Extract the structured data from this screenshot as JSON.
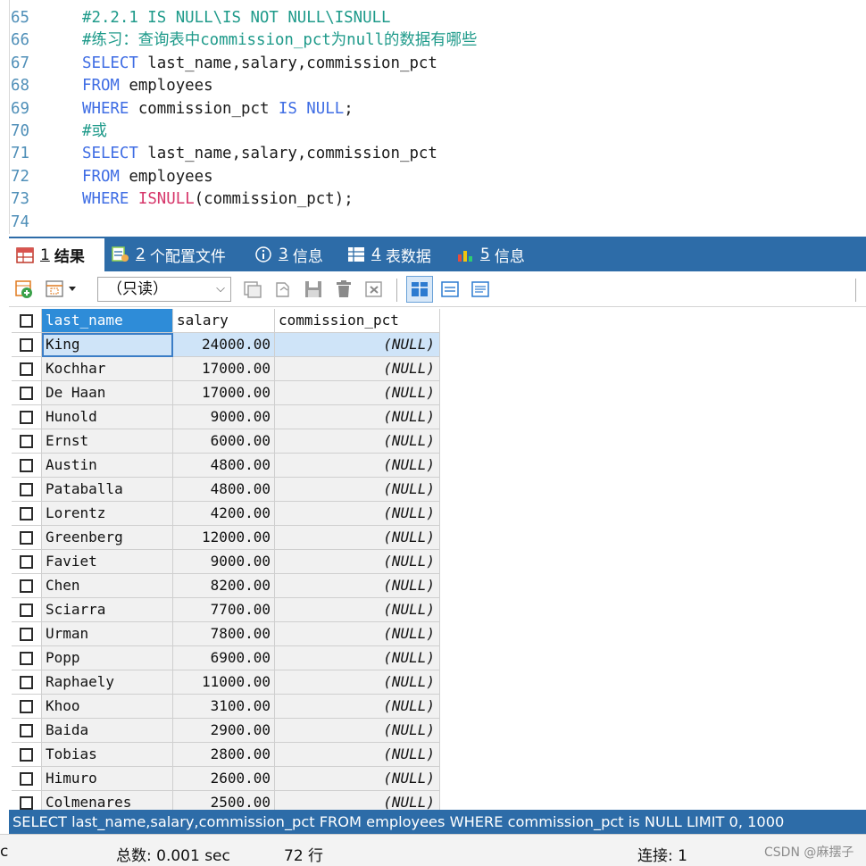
{
  "editor": {
    "lines": [
      {
        "n": "65",
        "tokens": [
          {
            "t": "#2.2.1 IS NULL\\IS NOT NULL\\ISNULL",
            "c": "cm"
          }
        ]
      },
      {
        "n": "66",
        "tokens": [
          {
            "t": "#练习：查询表中commission_pct为null的数据有哪些",
            "c": "cm"
          }
        ]
      },
      {
        "n": "67",
        "tokens": [
          {
            "t": "SELECT",
            "c": "kw"
          },
          {
            "t": " last_name,salary,commission_pct",
            "c": "id"
          }
        ]
      },
      {
        "n": "68",
        "tokens": [
          {
            "t": "FROM",
            "c": "kw"
          },
          {
            "t": " employees",
            "c": "id"
          }
        ]
      },
      {
        "n": "69",
        "tokens": [
          {
            "t": "WHERE",
            "c": "kw"
          },
          {
            "t": " commission_pct ",
            "c": "id"
          },
          {
            "t": "IS NULL",
            "c": "kw"
          },
          {
            "t": ";",
            "c": "id"
          }
        ]
      },
      {
        "n": "70",
        "tokens": [
          {
            "t": "#或",
            "c": "cm"
          }
        ]
      },
      {
        "n": "71",
        "tokens": [
          {
            "t": "SELECT",
            "c": "kw"
          },
          {
            "t": " last_name,salary,commission_pct",
            "c": "id"
          }
        ]
      },
      {
        "n": "72",
        "tokens": [
          {
            "t": "FROM",
            "c": "kw"
          },
          {
            "t": " employees",
            "c": "id"
          }
        ]
      },
      {
        "n": "73",
        "tokens": [
          {
            "t": "WHERE",
            "c": "kw"
          },
          {
            "t": " ",
            "c": "id"
          },
          {
            "t": "ISNULL",
            "c": "fn"
          },
          {
            "t": "(commission_pct);",
            "c": "id"
          }
        ]
      },
      {
        "n": "74",
        "tokens": []
      }
    ]
  },
  "tabs": [
    {
      "num": "1",
      "label": "结果",
      "icon": "grid-result-icon",
      "active": true
    },
    {
      "num": "2",
      "label": "个配置文件",
      "icon": "profile-icon",
      "active": false
    },
    {
      "num": "3",
      "label": "信息",
      "icon": "info-circle-icon",
      "active": false
    },
    {
      "num": "4",
      "label": "表数据",
      "icon": "table-data-icon",
      "active": false
    },
    {
      "num": "5",
      "label": "信息",
      "icon": "info-chart-icon",
      "active": false
    }
  ],
  "toolbar": {
    "mode_value": "（只读）",
    "icons": [
      "add-row-icon",
      "table-dropdown-icon",
      "duplicate-icon",
      "copy-icon",
      "save-icon",
      "delete-icon",
      "refresh-icon",
      "grid-view-icon",
      "form-view-icon",
      "text-view-icon"
    ]
  },
  "grid": {
    "columns": [
      "last_name",
      "salary",
      "commission_pct"
    ],
    "rows": [
      [
        "King",
        "24000.00",
        "(NULL)"
      ],
      [
        "Kochhar",
        "17000.00",
        "(NULL)"
      ],
      [
        "De Haan",
        "17000.00",
        "(NULL)"
      ],
      [
        "Hunold",
        "9000.00",
        "(NULL)"
      ],
      [
        "Ernst",
        "6000.00",
        "(NULL)"
      ],
      [
        "Austin",
        "4800.00",
        "(NULL)"
      ],
      [
        "Pataballa",
        "4800.00",
        "(NULL)"
      ],
      [
        "Lorentz",
        "4200.00",
        "(NULL)"
      ],
      [
        "Greenberg",
        "12000.00",
        "(NULL)"
      ],
      [
        "Faviet",
        "9000.00",
        "(NULL)"
      ],
      [
        "Chen",
        "8200.00",
        "(NULL)"
      ],
      [
        "Sciarra",
        "7700.00",
        "(NULL)"
      ],
      [
        "Urman",
        "7800.00",
        "(NULL)"
      ],
      [
        "Popp",
        "6900.00",
        "(NULL)"
      ],
      [
        "Raphaely",
        "11000.00",
        "(NULL)"
      ],
      [
        "Khoo",
        "3100.00",
        "(NULL)"
      ],
      [
        "Baida",
        "2900.00",
        "(NULL)"
      ],
      [
        "Tobias",
        "2800.00",
        "(NULL)"
      ],
      [
        "Himuro",
        "2600.00",
        "(NULL)"
      ],
      [
        "Colmenares",
        "2500.00",
        "(NULL)"
      ]
    ],
    "selected_row": 0
  },
  "sql_status": "SELECT last_name,salary,commission_pct FROM employees WHERE commission_pct is NULL LIMIT 0, 1000",
  "status_bar": {
    "left_fragment": "c",
    "time": "总数: 0.001 sec",
    "rows": "72 行",
    "connection": "连接: 1"
  },
  "watermark": "CSDN @麻摆子",
  "colors": {
    "accent_blue": "#2d6ca8",
    "keyword": "#3f6de4",
    "function": "#d6366a",
    "comment": "#1e9a8a",
    "header_selected": "#2e8cd8"
  }
}
